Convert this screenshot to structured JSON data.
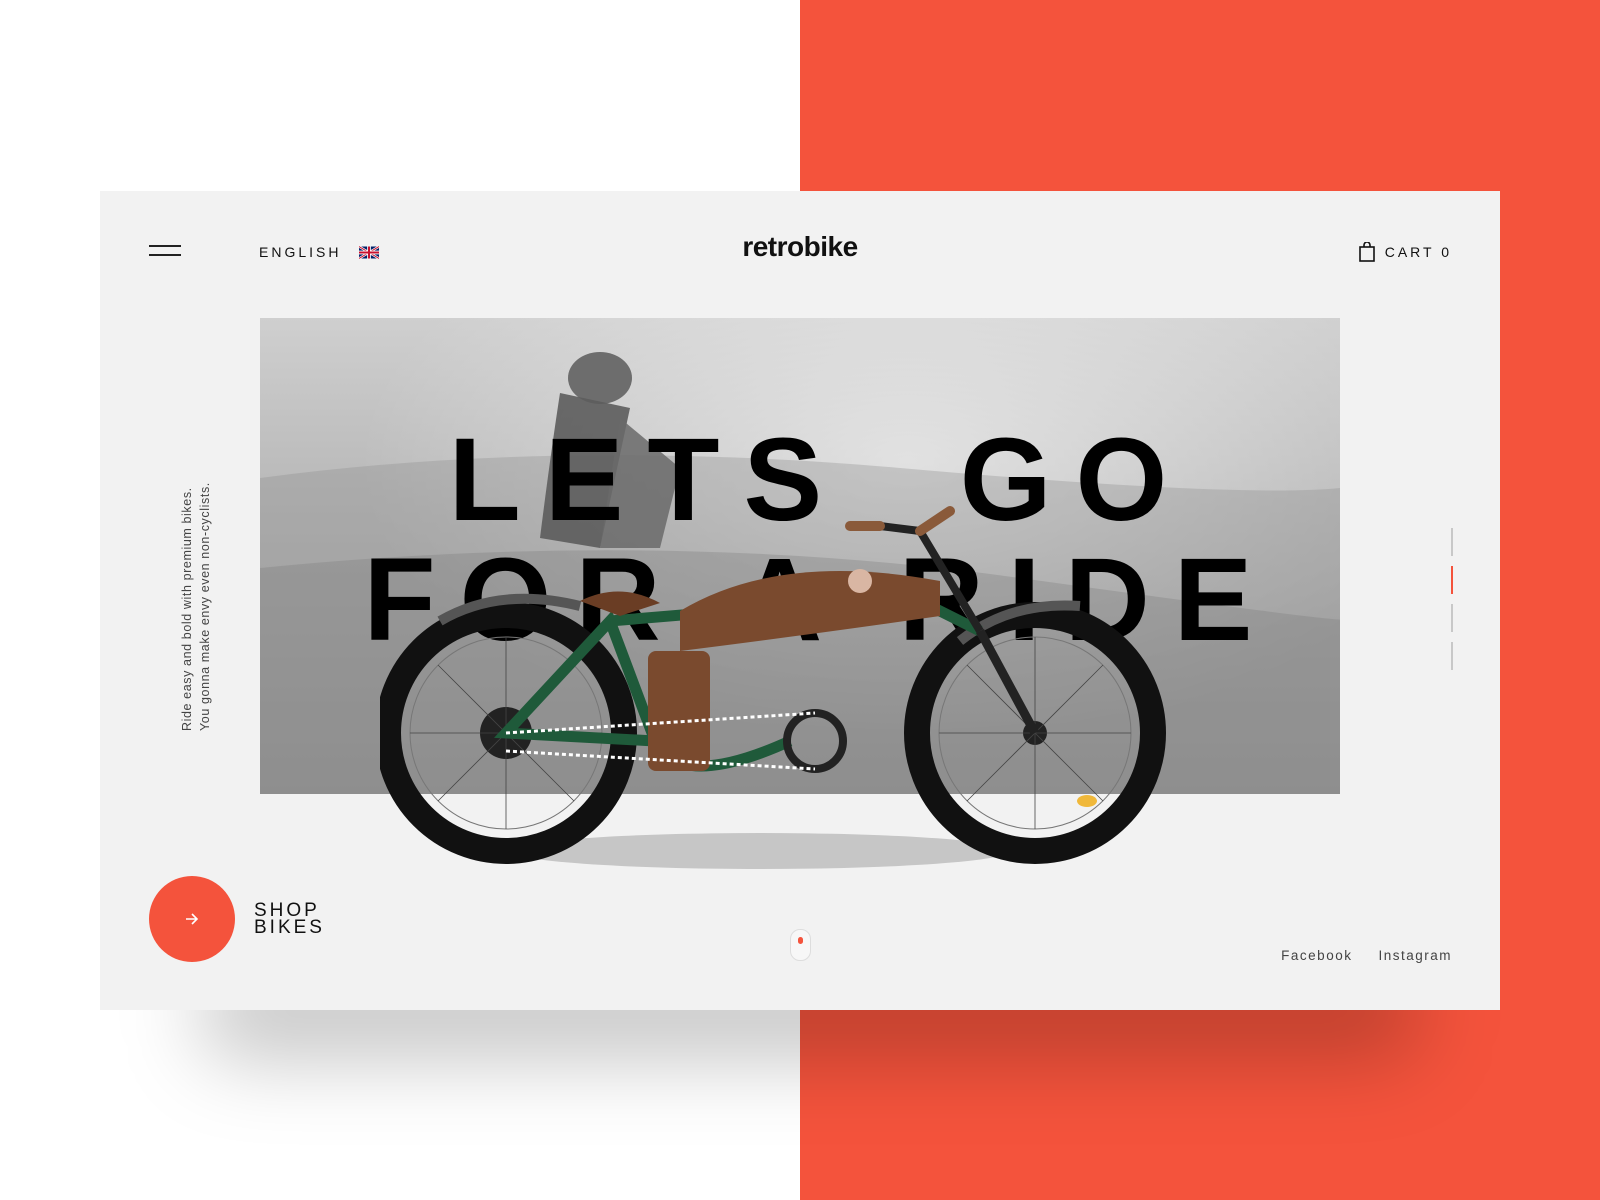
{
  "brand": {
    "logo_text": "retrobike",
    "accent_color": "#f4533c"
  },
  "header": {
    "menu_icon": "hamburger-menu-icon",
    "language_label": "ENGLISH",
    "language_flag": "uk-flag-icon",
    "cart_label": "CART 0",
    "cart_icon": "shopping-bag-icon"
  },
  "hero": {
    "headline_line1": "LETS  GO",
    "headline_line2": "FOR A RIDE",
    "tagline_line1": "Ride easy and bold with premium bikes.",
    "tagline_line2": "You gonna make envy even non-cyclists."
  },
  "slider": {
    "total_slides": 4,
    "active_index": 1
  },
  "cta": {
    "line1": "SHOP",
    "line2": "BIKES",
    "icon": "arrow-right-icon"
  },
  "social": {
    "facebook": "Facebook",
    "instagram": "Instagram"
  }
}
